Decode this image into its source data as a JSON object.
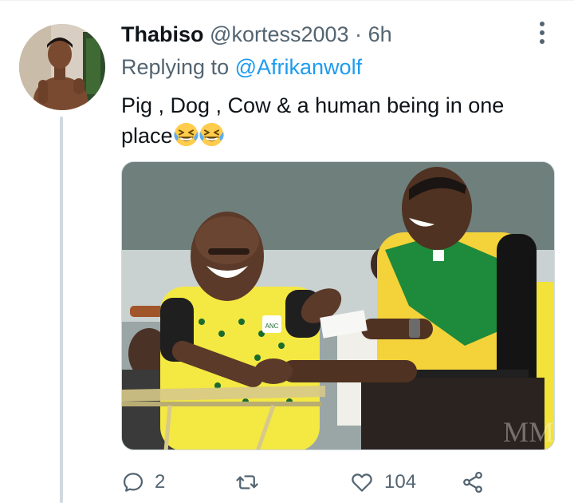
{
  "tweet": {
    "display_name": "Thabiso",
    "handle": "@kortess2003",
    "separator": "·",
    "time": "6h",
    "reply_prefix": "Replying to",
    "reply_to": "@Afrikanwolf",
    "text": "Pig , Dog , Cow & a human being in one place",
    "emojis": [
      "grinning-squinting-face-emoji",
      "grinning-squinting-face-emoji"
    ],
    "media_watermark": "MM",
    "media_logo": "ANC"
  },
  "actions": {
    "reply_count": "2",
    "retweet_count": "",
    "like_count": "104"
  },
  "icons": {
    "more": "more-vertical-icon",
    "reply": "reply-icon",
    "retweet": "retweet-icon",
    "like": "heart-icon",
    "share": "share-icon"
  },
  "colors": {
    "text": "#0f1419",
    "secondary": "#536471",
    "link": "#1d9bf0",
    "thread_line": "#cfd9de"
  }
}
